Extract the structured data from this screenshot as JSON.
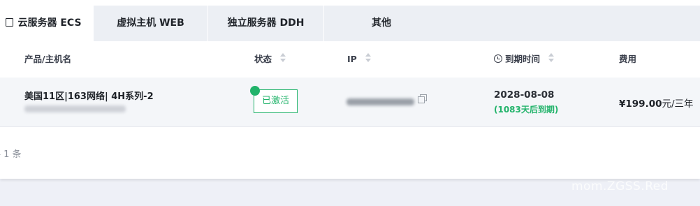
{
  "tabs": [
    {
      "label": "云服务器 ECS",
      "active": true
    },
    {
      "label": "虚拟主机 WEB",
      "active": false
    },
    {
      "label": "独立服务器 DDH",
      "active": false
    },
    {
      "label": "其他",
      "active": false
    }
  ],
  "columns": {
    "product": "产品/主机名",
    "status": "状态",
    "ip": "IP",
    "expire": "到期时间",
    "fee": "费用"
  },
  "row": {
    "product_name": "美国11区|163网络| 4H系列-2",
    "status": "已激活",
    "expire_date": "2028-08-08",
    "expire_remaining": "(1083天后到期)",
    "fee_amount": "¥199.00",
    "fee_unit": "元/三年"
  },
  "total_text": "共 1 条",
  "watermark": "mom.ZGSS.Red",
  "colors": {
    "accent_green": "#21b36a",
    "tab_bg": "#eceff4",
    "page_bg": "#eef0f7"
  }
}
